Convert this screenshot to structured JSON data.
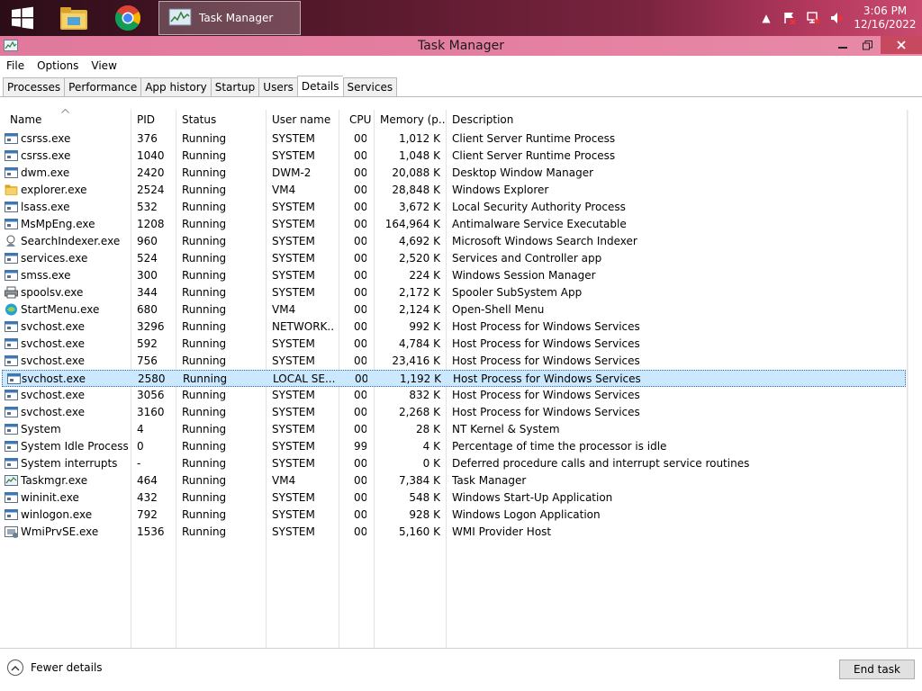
{
  "taskbar": {
    "task_label": "Task Manager",
    "clock_time": "3:06 PM",
    "clock_date": "12/16/2022"
  },
  "window": {
    "title": "Task Manager"
  },
  "menu": [
    "File",
    "Options",
    "View"
  ],
  "tabs": [
    "Processes",
    "Performance",
    "App history",
    "Startup",
    "Users",
    "Details",
    "Services"
  ],
  "active_tab": "Details",
  "columns": [
    "Name",
    "PID",
    "Status",
    "User name",
    "CPU",
    "Memory (p...",
    "Description"
  ],
  "rows": [
    {
      "name": "csrss.exe",
      "pid": "376",
      "status": "Running",
      "user": "SYSTEM",
      "cpu": "00",
      "mem": "1,012 K",
      "desc": "Client Server Runtime Process",
      "icon": "exe"
    },
    {
      "name": "csrss.exe",
      "pid": "1040",
      "status": "Running",
      "user": "SYSTEM",
      "cpu": "00",
      "mem": "1,048 K",
      "desc": "Client Server Runtime Process",
      "icon": "exe"
    },
    {
      "name": "dwm.exe",
      "pid": "2420",
      "status": "Running",
      "user": "DWM-2",
      "cpu": "00",
      "mem": "20,088 K",
      "desc": "Desktop Window Manager",
      "icon": "exe"
    },
    {
      "name": "explorer.exe",
      "pid": "2524",
      "status": "Running",
      "user": "VM4",
      "cpu": "00",
      "mem": "28,848 K",
      "desc": "Windows Explorer",
      "icon": "folder"
    },
    {
      "name": "lsass.exe",
      "pid": "532",
      "status": "Running",
      "user": "SYSTEM",
      "cpu": "00",
      "mem": "3,672 K",
      "desc": "Local Security Authority Process",
      "icon": "exe"
    },
    {
      "name": "MsMpEng.exe",
      "pid": "1208",
      "status": "Running",
      "user": "SYSTEM",
      "cpu": "00",
      "mem": "164,964 K",
      "desc": "Antimalware Service Executable",
      "icon": "exe"
    },
    {
      "name": "SearchIndexer.exe",
      "pid": "960",
      "status": "Running",
      "user": "SYSTEM",
      "cpu": "00",
      "mem": "4,692 K",
      "desc": "Microsoft Windows Search Indexer",
      "icon": "search"
    },
    {
      "name": "services.exe",
      "pid": "524",
      "status": "Running",
      "user": "SYSTEM",
      "cpu": "00",
      "mem": "2,520 K",
      "desc": "Services and Controller app",
      "icon": "exe"
    },
    {
      "name": "smss.exe",
      "pid": "300",
      "status": "Running",
      "user": "SYSTEM",
      "cpu": "00",
      "mem": "224 K",
      "desc": "Windows Session Manager",
      "icon": "exe"
    },
    {
      "name": "spoolsv.exe",
      "pid": "344",
      "status": "Running",
      "user": "SYSTEM",
      "cpu": "00",
      "mem": "2,172 K",
      "desc": "Spooler SubSystem App",
      "icon": "printer"
    },
    {
      "name": "StartMenu.exe",
      "pid": "680",
      "status": "Running",
      "user": "VM4",
      "cpu": "00",
      "mem": "2,124 K",
      "desc": "Open-Shell Menu",
      "icon": "shell"
    },
    {
      "name": "svchost.exe",
      "pid": "3296",
      "status": "Running",
      "user": "NETWORK...",
      "cpu": "00",
      "mem": "992 K",
      "desc": "Host Process for Windows Services",
      "icon": "exe"
    },
    {
      "name": "svchost.exe",
      "pid": "592",
      "status": "Running",
      "user": "SYSTEM",
      "cpu": "00",
      "mem": "4,784 K",
      "desc": "Host Process for Windows Services",
      "icon": "exe"
    },
    {
      "name": "svchost.exe",
      "pid": "756",
      "status": "Running",
      "user": "SYSTEM",
      "cpu": "00",
      "mem": "23,416 K",
      "desc": "Host Process for Windows Services",
      "icon": "exe"
    },
    {
      "name": "svchost.exe",
      "pid": "2580",
      "status": "Running",
      "user": "LOCAL SE...",
      "cpu": "00",
      "mem": "1,192 K",
      "desc": "Host Process for Windows Services",
      "icon": "exe",
      "selected": true
    },
    {
      "name": "svchost.exe",
      "pid": "3056",
      "status": "Running",
      "user": "SYSTEM",
      "cpu": "00",
      "mem": "832 K",
      "desc": "Host Process for Windows Services",
      "icon": "exe"
    },
    {
      "name": "svchost.exe",
      "pid": "3160",
      "status": "Running",
      "user": "SYSTEM",
      "cpu": "00",
      "mem": "2,268 K",
      "desc": "Host Process for Windows Services",
      "icon": "exe"
    },
    {
      "name": "System",
      "pid": "4",
      "status": "Running",
      "user": "SYSTEM",
      "cpu": "00",
      "mem": "28 K",
      "desc": "NT Kernel & System",
      "icon": "exe"
    },
    {
      "name": "System Idle Process",
      "pid": "0",
      "status": "Running",
      "user": "SYSTEM",
      "cpu": "99",
      "mem": "4 K",
      "desc": "Percentage of time the processor is idle",
      "icon": "exe"
    },
    {
      "name": "System interrupts",
      "pid": "-",
      "status": "Running",
      "user": "SYSTEM",
      "cpu": "00",
      "mem": "0 K",
      "desc": "Deferred procedure calls and interrupt service routines",
      "icon": "exe"
    },
    {
      "name": "Taskmgr.exe",
      "pid": "464",
      "status": "Running",
      "user": "VM4",
      "cpu": "00",
      "mem": "7,384 K",
      "desc": "Task Manager",
      "icon": "taskmgr"
    },
    {
      "name": "wininit.exe",
      "pid": "432",
      "status": "Running",
      "user": "SYSTEM",
      "cpu": "00",
      "mem": "548 K",
      "desc": "Windows Start-Up Application",
      "icon": "exe"
    },
    {
      "name": "winlogon.exe",
      "pid": "792",
      "status": "Running",
      "user": "SYSTEM",
      "cpu": "00",
      "mem": "928 K",
      "desc": "Windows Logon Application",
      "icon": "exe"
    },
    {
      "name": "WmiPrvSE.exe",
      "pid": "1536",
      "status": "Running",
      "user": "SYSTEM",
      "cpu": "00",
      "mem": "5,160 K",
      "desc": "WMI Provider Host",
      "icon": "wmi"
    }
  ],
  "footer": {
    "fewer_details": "Fewer details",
    "end_task": "End task"
  }
}
